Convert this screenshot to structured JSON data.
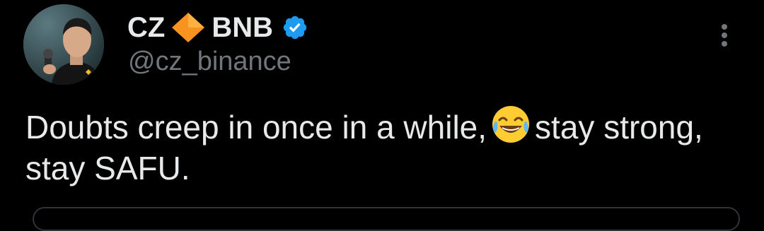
{
  "tweet": {
    "display_name_prefix": "CZ",
    "display_name_suffix": "BNB",
    "handle": "@cz_binance",
    "text_part1": "Doubts creep in once in a while,",
    "text_part2": "stay strong, stay SAFU.",
    "emoji": "face-with-tears-of-joy",
    "icons": {
      "name_emoji": "orange-diamond-icon",
      "verified": "verified-badge-icon",
      "more": "more-options-icon"
    }
  },
  "colors": {
    "background": "#000000",
    "text_primary": "#e7e9ea",
    "text_secondary": "#71767b",
    "verified": "#1d9bf0",
    "diamond": "#f7931e"
  }
}
